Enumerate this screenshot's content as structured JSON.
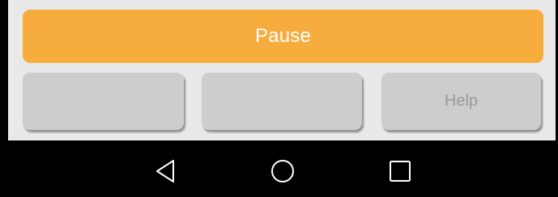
{
  "app": {
    "pause_label": "Pause",
    "buttons": [
      {
        "label": ""
      },
      {
        "label": ""
      },
      {
        "label": "Help"
      }
    ]
  },
  "nav_bar": {
    "icons": [
      "back-icon",
      "home-icon",
      "recents-icon"
    ]
  },
  "colors": {
    "pause_bg": "#f6ad3e",
    "pause_text": "#ffffff",
    "button_bg": "#cdcdcd",
    "button_text": "#9b9b9b",
    "panel_bg": "#e9e9e9",
    "nav_bg": "#000000",
    "nav_icon": "#ffffff"
  }
}
